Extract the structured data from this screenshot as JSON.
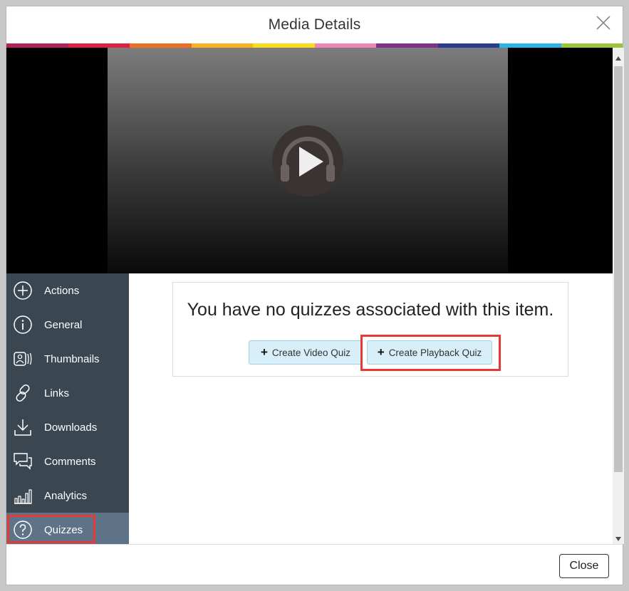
{
  "dialog": {
    "title": "Media Details",
    "close_label": "Close"
  },
  "accent_colors": [
    "#b51f5c",
    "#e0203f",
    "#f06c23",
    "#f7b21d",
    "#f5de1e",
    "#ef85b3",
    "#83308d",
    "#2a3c8f",
    "#29b6e6",
    "#9bc63b"
  ],
  "player": {
    "play_icon": "headphones-play-icon"
  },
  "sidebar": {
    "items": [
      {
        "label": "Actions",
        "icon": "plus-circle-icon"
      },
      {
        "label": "General",
        "icon": "info-icon"
      },
      {
        "label": "Thumbnails",
        "icon": "thumbnails-icon"
      },
      {
        "label": "Links",
        "icon": "link-icon"
      },
      {
        "label": "Downloads",
        "icon": "download-icon"
      },
      {
        "label": "Comments",
        "icon": "comments-icon"
      },
      {
        "label": "Analytics",
        "icon": "analytics-icon"
      },
      {
        "label": "Quizzes",
        "icon": "question-icon"
      }
    ],
    "active": "Quizzes"
  },
  "quizzes": {
    "message": "You have no quizzes associated with this item.",
    "create_video_quiz": "Create Video Quiz",
    "create_playback_quiz": "Create Playback Quiz"
  }
}
